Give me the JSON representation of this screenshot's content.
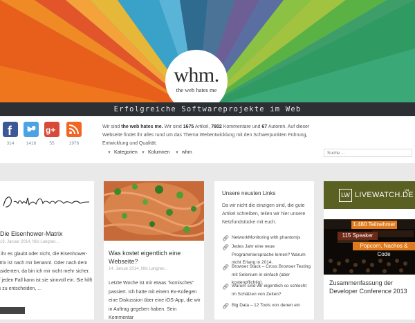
{
  "header": {
    "logo_word": "whm.",
    "logo_tagline": "the web hates me",
    "slogan": "Erfolgreiche Softwareprojekte im Web"
  },
  "social": [
    {
      "icon": "facebook-icon",
      "count": "314",
      "color": "#3b5998"
    },
    {
      "icon": "twitter-icon",
      "count": "1418",
      "color": "#4ba3e5"
    },
    {
      "icon": "google-plus-icon",
      "count": "55",
      "color": "#d84a38"
    },
    {
      "icon": "rss-icon",
      "count": "1976",
      "color": "#f26522"
    }
  ],
  "about": {
    "p1": "Wir sind ",
    "name": "the web hates me.",
    "p2": " Wir sind ",
    "articles": "1675",
    "p3": " Artikel, ",
    "comments": "7802",
    "p4": " Kommentare und ",
    "authors": "67",
    "p5": " Autoren. Auf dieser Webseite findet ihr alles rund um das Thema Webentwicklung mit den Schwerpunkten Führung, Entwicklung und Qualität."
  },
  "menu": [
    "Kategorien",
    "Kolumnen",
    "whm"
  ],
  "search": {
    "placeholder": "Suche ..."
  },
  "cards": {
    "c1": {
      "title": "Die Eisenhower-Matrix",
      "meta": "16. Januar 2014, Nils Langner...",
      "excerpt": "Ob ihr es glaubt oder nicht, die Eisenhower-Matrix ist nach mir benannt. Oder nach dem Präsidenten, da bin ich mir nicht mehr sicher. Auf jeden Fall kann ist sie sinnvoll ein. Sie hilft uns zu entscheiden, ..."
    },
    "c2": {
      "title": "Was kostet eigentlich eine Webseite?",
      "meta": "14. Januar 2014, Nils Langner...",
      "excerpt": "Letzte Woche ist mir etwas \"komisches\" passiert. Ich hatte mit einem Ex-Kollegen eine Diskussion über eine iOS-App, die wir in Auftrag gegeben haben. Sein Kommentar"
    },
    "c3": {
      "title": "Unsere neusten Links",
      "intro": "Da wir nicht die einzigen sind, die gute Artikel schreiben, teilen wir hier unsere Netzfundstücke mit euch.",
      "links": [
        "NetworkMonitoring with phantomjs",
        "Jedes Jahr eine neue Programmiersprache lernen? Warum nicht Erlang in 2014.",
        "Browser Stack – Cross Browser Testing mit Selenium in einfach (aber kostenpflichtig).",
        "Warum sind wir eigentlich so schlecht im Schätzen von Zeiten?",
        "Big Data – 12 Tools von denen ein"
      ]
    },
    "c4": {
      "ad_name": "LIVEWATCH.DE",
      "ad_box": "LW",
      "ad_version": "V4",
      "pills": [
        "1.480 Teilnehmer",
        "115 Speaker",
        "Popcorn, Nachos & Code"
      ],
      "title": "Zusammenfassung der Developer Conference 2013"
    }
  }
}
